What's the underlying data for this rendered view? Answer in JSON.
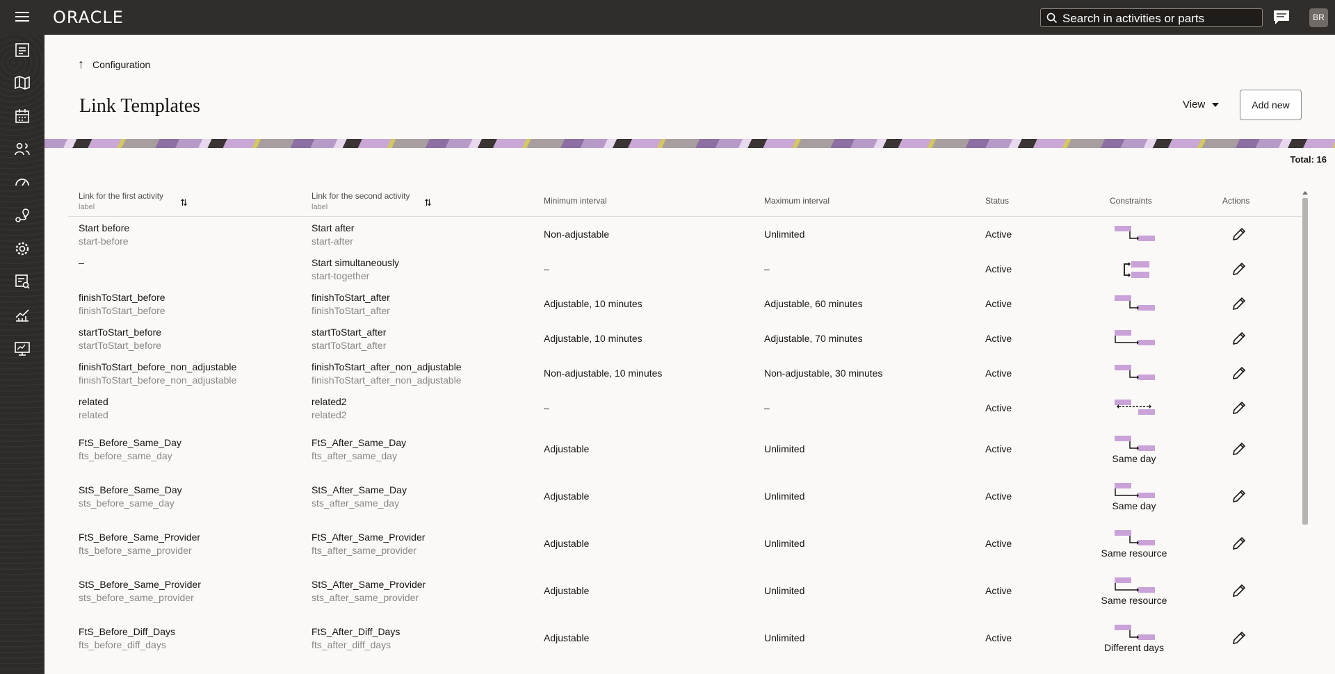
{
  "app": {
    "logo_text": "ORACLE"
  },
  "header": {
    "search_placeholder": "Search in activities or parts",
    "avatar_initials": "BR"
  },
  "rail": {
    "icons": [
      "dispatch-console-icon",
      "map-icon",
      "calendar-icon",
      "resources-icon",
      "dashboard-icon",
      "routing-icon",
      "settings-icon",
      "reports-icon",
      "analytics-icon",
      "monitor-icon"
    ]
  },
  "breadcrumb": {
    "label": "Configuration"
  },
  "page": {
    "title": "Link Templates",
    "view_label": "View",
    "add_new_label": "Add new",
    "total_label": "Total: 16"
  },
  "table": {
    "columns": {
      "first": "Link for the first activity",
      "first_sub": "label",
      "second": "Link for the second activity",
      "second_sub": "label",
      "min": "Minimum interval",
      "max": "Maximum interval",
      "status": "Status",
      "constraints": "Constraints",
      "actions": "Actions"
    },
    "rows": [
      {
        "first": "Start before",
        "first_sub": "start-before",
        "second": "Start after",
        "second_sub": "start-after",
        "min": "Non-adjustable",
        "max": "Unlimited",
        "status": "Active",
        "diagram": "fts",
        "note": ""
      },
      {
        "first": "–",
        "first_sub": "",
        "second": "Start simultaneously",
        "second_sub": "start-together",
        "min": "–",
        "max": "–",
        "status": "Active",
        "diagram": "together",
        "note": ""
      },
      {
        "first": "finishToStart_before",
        "first_sub": "finishToStart_before",
        "second": "finishToStart_after",
        "second_sub": "finishToStart_after",
        "min": "Adjustable, 10 minutes",
        "max": "Adjustable, 60 minutes",
        "status": "Active",
        "diagram": "fts",
        "note": ""
      },
      {
        "first": "startToStart_before",
        "first_sub": "startToStart_before",
        "second": "startToStart_after",
        "second_sub": "startToStart_after",
        "min": "Adjustable, 10 minutes",
        "max": "Adjustable, 70 minutes",
        "status": "Active",
        "diagram": "sts",
        "note": ""
      },
      {
        "first": "finishToStart_before_non_adjustable",
        "first_sub": "finishToStart_before_non_adjustable",
        "second": "finishToStart_after_non_adjustable",
        "second_sub": "finishToStart_after_non_adjustable",
        "min": "Non-adjustable, 10 minutes",
        "max": "Non-adjustable, 30 minutes",
        "status": "Active",
        "diagram": "fts",
        "note": ""
      },
      {
        "first": "related",
        "first_sub": "related",
        "second": "related2",
        "second_sub": "related2",
        "min": "–",
        "max": "–",
        "status": "Active",
        "diagram": "related",
        "note": ""
      },
      {
        "first": "FtS_Before_Same_Day",
        "first_sub": "fts_before_same_day",
        "second": "FtS_After_Same_Day",
        "second_sub": "fts_after_same_day",
        "min": "Adjustable",
        "max": "Unlimited",
        "status": "Active",
        "diagram": "fts",
        "note": "Same day"
      },
      {
        "first": "StS_Before_Same_Day",
        "first_sub": "sts_before_same_day",
        "second": "StS_After_Same_Day",
        "second_sub": "sts_after_same_day",
        "min": "Adjustable",
        "max": "Unlimited",
        "status": "Active",
        "diagram": "sts",
        "note": "Same day"
      },
      {
        "first": "FtS_Before_Same_Provider",
        "first_sub": "fts_before_same_provider",
        "second": "FtS_After_Same_Provider",
        "second_sub": "fts_after_same_provider",
        "min": "Adjustable",
        "max": "Unlimited",
        "status": "Active",
        "diagram": "fts",
        "note": "Same resource"
      },
      {
        "first": "StS_Before_Same_Provider",
        "first_sub": "sts_before_same_provider",
        "second": "StS_After_Same_Provider",
        "second_sub": "sts_after_same_provider",
        "min": "Adjustable",
        "max": "Unlimited",
        "status": "Active",
        "diagram": "sts",
        "note": "Same resource"
      },
      {
        "first": "FtS_Before_Diff_Days",
        "first_sub": "fts_before_diff_days",
        "second": "FtS_After_Diff_Days",
        "second_sub": "fts_after_diff_days",
        "min": "Adjustable",
        "max": "Unlimited",
        "status": "Active",
        "diagram": "fts",
        "note": "Different days"
      }
    ]
  }
}
